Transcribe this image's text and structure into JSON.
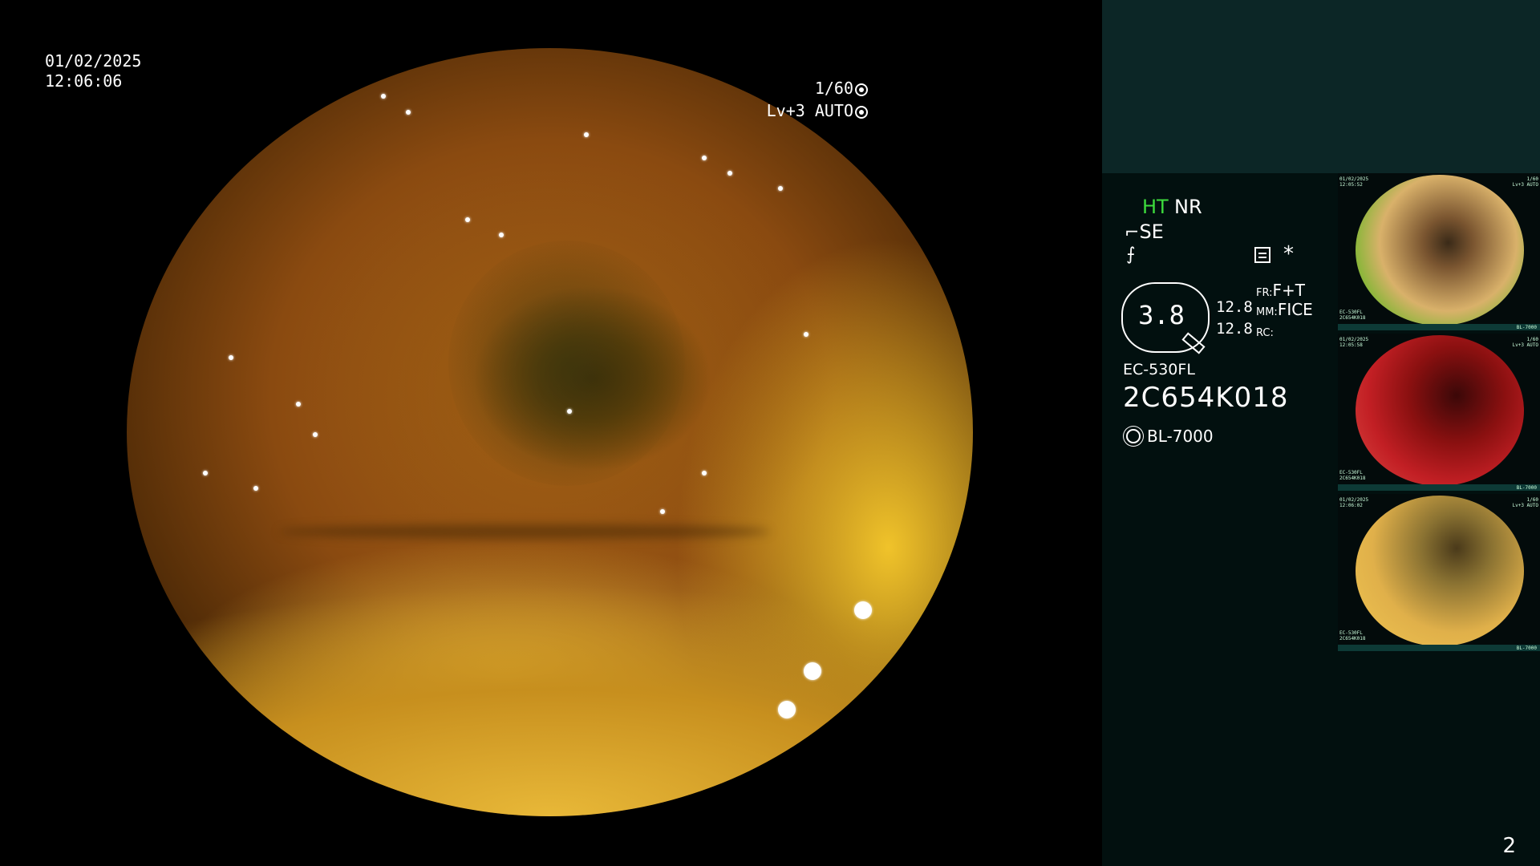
{
  "live": {
    "date": "01/02/2025",
    "time": "12:06:06",
    "shutter_speed": "1/60",
    "iris_mode": "Lv+3 AUTO"
  },
  "panel": {
    "ht_label": "HT",
    "nr_label": "NR",
    "se_label": "SE",
    "se_glyph": "⌐",
    "enhance_glyph": "⨍",
    "star_glyph": "*",
    "zoom_value": "3.8",
    "zoom_values": [
      "12.8",
      "12.8"
    ],
    "fr_key": "FR:",
    "fr_value": "F+T",
    "mm_key": "MM:",
    "mm_value": "FICE",
    "rc_key": "RC:",
    "rc_value": "",
    "scope_model": "EC-530FL",
    "scope_serial": "2C654K018",
    "light_source": "BL-7000"
  },
  "thumbnails": [
    {
      "label_tl": "01/02/2025\n12:05:52",
      "label_tr": "1/60\nLv+3 AUTO",
      "label_bl": "EC-530FL\n2C654K018",
      "label_br": "BL-7000"
    },
    {
      "label_tl": "01/02/2025\n12:05:58",
      "label_tr": "1/60\nLv+3 AUTO",
      "label_bl": "EC-530FL\n2C654K018",
      "label_br": "BL-7000"
    },
    {
      "label_tl": "01/02/2025\n12:06:02",
      "label_tr": "1/60\nLv+3 AUTO",
      "label_bl": "EC-530FL\n2C654K018",
      "label_br": "BL-7000"
    }
  ],
  "page_number": "2",
  "colors": {
    "ht_green": "#3ddc3d",
    "panel_bg": "#02100f",
    "panel_header": "#0c2626"
  },
  "icons": {
    "shutter": "aperture-icon",
    "iris": "iris-icon",
    "menu": "menu-icon",
    "light": "sun-icon"
  }
}
